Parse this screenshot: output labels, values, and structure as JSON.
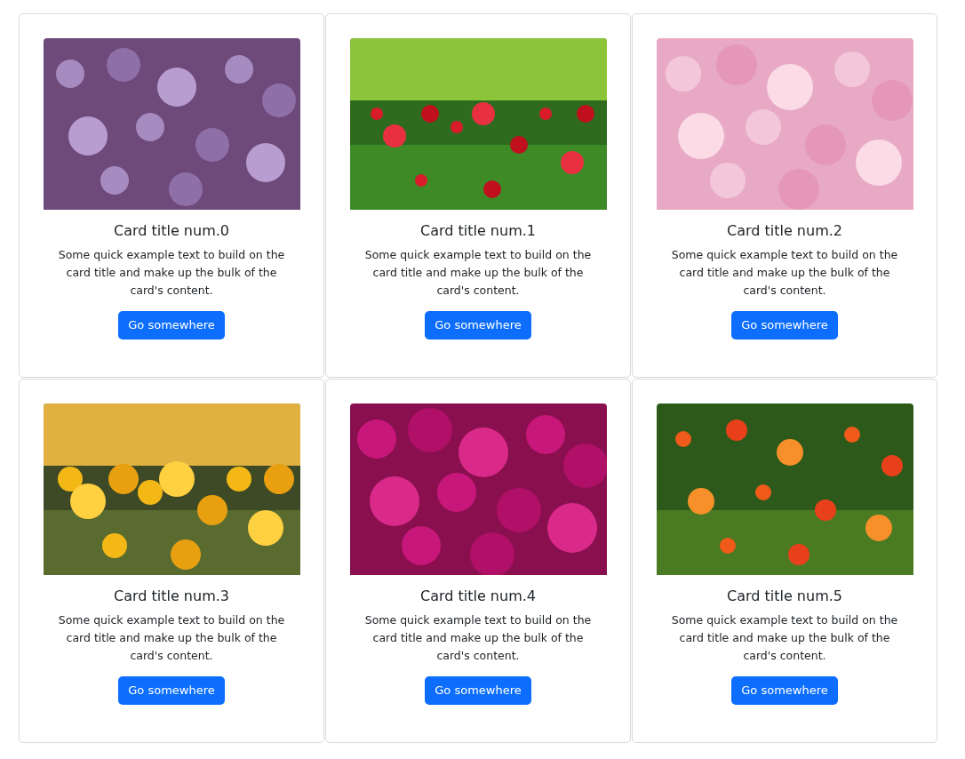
{
  "cards": [
    {
      "title": "Card title num.0",
      "text": "Some quick example text to build on the card title and make up the bulk of the card's content.",
      "button": "Go somewhere"
    },
    {
      "title": "Card title num.1",
      "text": "Some quick example text to build on the card title and make up the bulk of the card's content.",
      "button": "Go somewhere"
    },
    {
      "title": "Card title num.2",
      "text": "Some quick example text to build on the card title and make up the bulk of the card's content.",
      "button": "Go somewhere"
    },
    {
      "title": "Card title num.3",
      "text": "Some quick example text to build on the card title and make up the bulk of the card's content.",
      "button": "Go somewhere"
    },
    {
      "title": "Card title num.4",
      "text": "Some quick example text to build on the card title and make up the bulk of the card's content.",
      "button": "Go somewhere"
    },
    {
      "title": "Card title num.5",
      "text": "Some quick example text to build on the card title and make up the bulk of the card's content.",
      "button": "Go somewhere"
    }
  ]
}
